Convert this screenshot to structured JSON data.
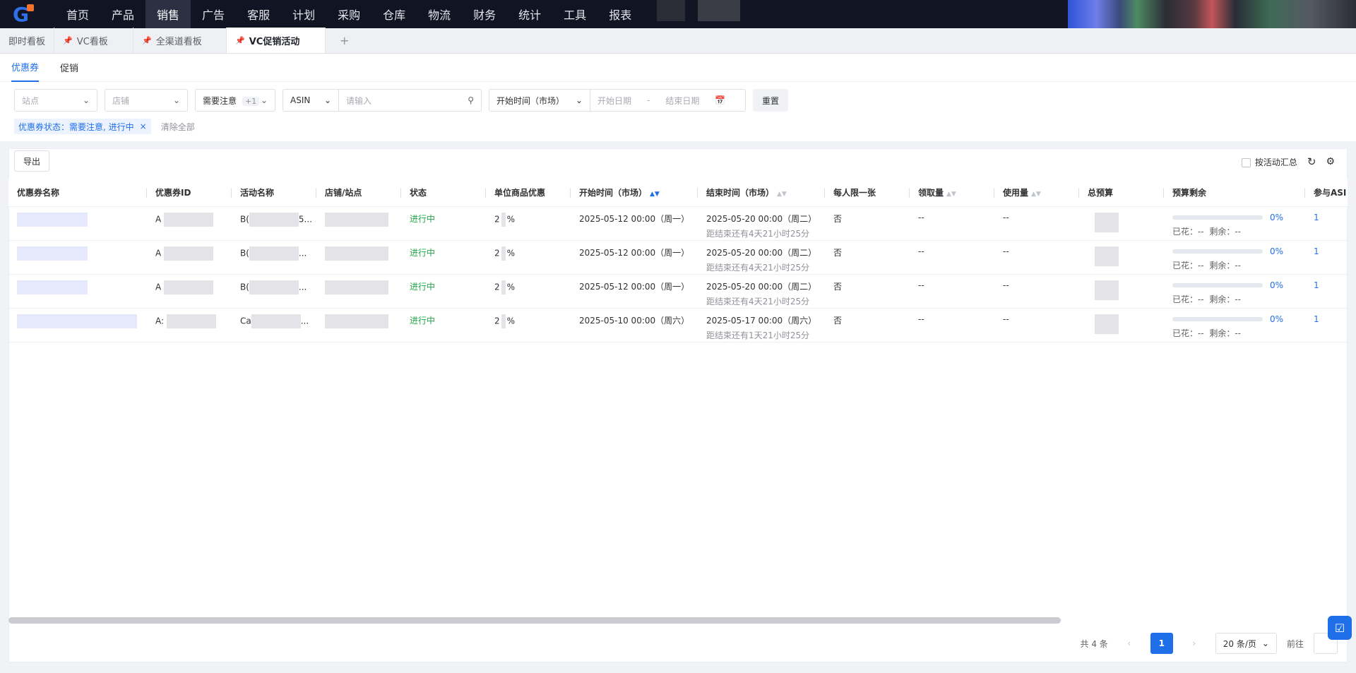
{
  "nav": {
    "items": [
      "首页",
      "产品",
      "销售",
      "广告",
      "客服",
      "计划",
      "采购",
      "仓库",
      "物流",
      "财务",
      "统计",
      "工具",
      "报表"
    ],
    "active_index": 2
  },
  "page_tabs": [
    {
      "label": "即时看板",
      "pinned": false
    },
    {
      "label": "VC看板",
      "pinned": true
    },
    {
      "label": "全渠道看板",
      "pinned": true
    },
    {
      "label": "VC促销活动",
      "pinned": true,
      "active": true
    }
  ],
  "add_tab_icon": "+",
  "subtabs": [
    "优惠券",
    "促销"
  ],
  "filters": {
    "site_placeholder": "站点",
    "store_placeholder": "店铺",
    "attention_label": "需要注意",
    "attention_extra": "+1",
    "asin_type": "ASIN",
    "asin_placeholder": "请输入",
    "date_type": "开始时间（市场）",
    "start_placeholder": "开始日期",
    "date_sep": "-",
    "end_placeholder": "结束日期",
    "reset_label": "重置"
  },
  "active_chip": "优惠券状态：需要注意, 进行中",
  "clear_all": "清除全部",
  "toolbar": {
    "export_label": "导出",
    "group_label": "按活动汇总"
  },
  "columns": [
    "优惠券名称",
    "优惠券ID",
    "活动名称",
    "店铺/站点",
    "状态",
    "单位商品优惠",
    "开始时间（市场）",
    "结束时间（市场）",
    "每人限一张",
    "领取量",
    "使用量",
    "总预算",
    "预算剩余",
    "参与ASI"
  ],
  "rows": [
    {
      "id_prefix": "A",
      "campaign_prefix": "B(",
      "campaign_suffix": "5...",
      "status": "进行中",
      "discount_prefix": "2",
      "discount_suffix": "%",
      "start": "2025-05-12 00:00（周一）",
      "end": "2025-05-20 00:00（周二）",
      "remain": "距结束还有4天21小时25分",
      "limit": "否",
      "claimed": "--",
      "used": "--",
      "budget_pct": "0%",
      "spent": "已花：--",
      "left": "剩余：--",
      "asin_count": "1"
    },
    {
      "id_prefix": "A",
      "campaign_prefix": "B(",
      "campaign_suffix": "...",
      "status": "进行中",
      "discount_prefix": "2",
      "discount_suffix": "%",
      "start": "2025-05-12 00:00（周一）",
      "end": "2025-05-20 00:00（周二）",
      "remain": "距结束还有4天21小时25分",
      "limit": "否",
      "claimed": "--",
      "used": "--",
      "budget_pct": "0%",
      "spent": "已花：--",
      "left": "剩余：--",
      "asin_count": "1"
    },
    {
      "id_prefix": "A",
      "campaign_prefix": "B(",
      "campaign_suffix": "...",
      "status": "进行中",
      "discount_prefix": "2",
      "discount_suffix": "%",
      "start": "2025-05-12 00:00（周一）",
      "end": "2025-05-20 00:00（周二）",
      "remain": "距结束还有4天21小时25分",
      "limit": "否",
      "claimed": "--",
      "used": "--",
      "budget_pct": "0%",
      "spent": "已花：--",
      "left": "剩余：--",
      "asin_count": "1"
    },
    {
      "id_prefix": "A:",
      "campaign_prefix": "Ca",
      "campaign_suffix": "...",
      "status": "进行中",
      "discount_prefix": "2",
      "discount_suffix": "%",
      "start": "2025-05-10 00:00（周六）",
      "end": "2025-05-17 00:00（周六）",
      "remain": "距结束还有1天21小时25分",
      "limit": "否",
      "claimed": "--",
      "used": "--",
      "budget_pct": "0%",
      "spent": "已花：--",
      "left": "剩余：--",
      "asin_count": "1"
    }
  ],
  "pagination": {
    "total": "共 4 条",
    "current": "1",
    "page_size": "20 条/页",
    "goto": "前往"
  },
  "colors": {
    "accent": "#1f6fe8",
    "nav_bg": "#101423",
    "status_green": "#22a84a"
  }
}
